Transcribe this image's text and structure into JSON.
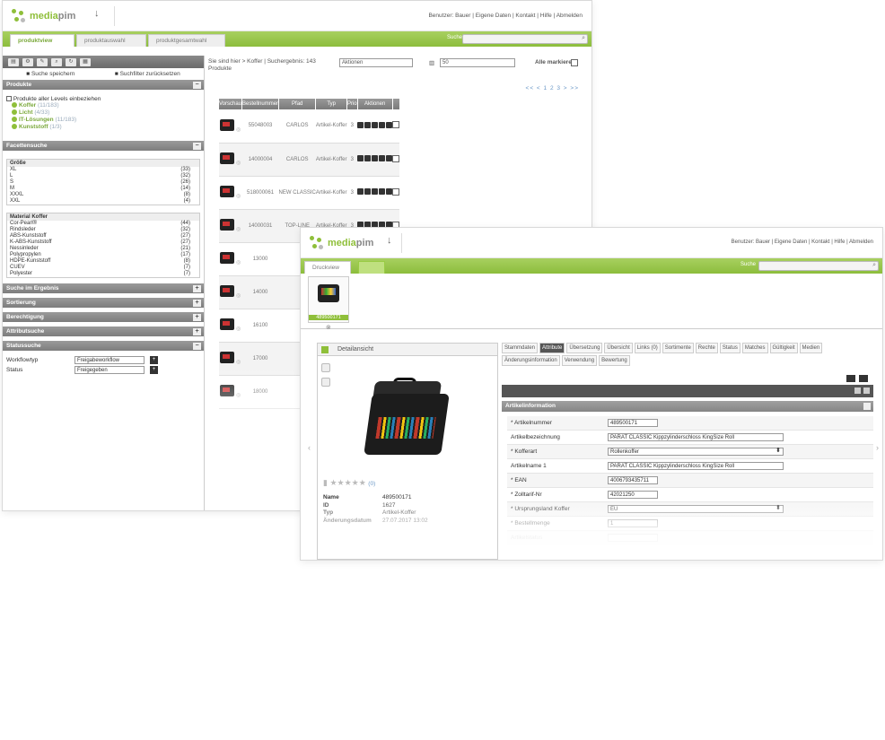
{
  "window1": {
    "user_links": "Benutzer: Bauer  |  Eigene Daten  |  Kontakt  |  Hilfe  |  Abmelden",
    "tabs": [
      "produktview",
      "produktauswahl",
      "produktgesamtwahl"
    ],
    "search_label": "Suche",
    "sidebar": {
      "save_search": "Suche speichern",
      "reset_filter": "Suchfilter zurücksetzen",
      "produkte_header": "Produkte",
      "include_all_levels": "Produkte aller Levels einbeziehen",
      "tree": [
        {
          "name": "Koffer",
          "count": "(11/183)"
        },
        {
          "name": "Licht",
          "count": "(4/33)"
        },
        {
          "name": "IT-Lösungen",
          "count": "(11/183)"
        },
        {
          "name": "Kunststoff",
          "count": "(1/3)"
        }
      ],
      "facet_header": "Facettensuche",
      "groesse_title": "Größe",
      "groesse": [
        {
          "k": "XL",
          "v": "(33)"
        },
        {
          "k": "L",
          "v": "(32)"
        },
        {
          "k": "S",
          "v": "(26)"
        },
        {
          "k": "M",
          "v": "(14)"
        },
        {
          "k": "XXXL",
          "v": "(8)"
        },
        {
          "k": "XXL",
          "v": "(4)"
        }
      ],
      "material_title": "Material Koffer",
      "material": [
        {
          "k": "Cor-Pearl®",
          "v": "(44)"
        },
        {
          "k": "Rindsleder",
          "v": "(32)"
        },
        {
          "k": "ABS-Kunststoff",
          "v": "(27)"
        },
        {
          "k": "K-ABS-Kunststoff",
          "v": "(27)"
        },
        {
          "k": "Nessinleder",
          "v": "(21)"
        },
        {
          "k": "Polypropylen",
          "v": "(17)"
        },
        {
          "k": "HDPE-Kunststoff",
          "v": "(8)"
        },
        {
          "k": "CUEV",
          "v": "(7)"
        },
        {
          "k": "Polyester",
          "v": "(7)"
        }
      ],
      "sections": [
        "Suche im Ergebnis",
        "Sortierung",
        "Berechtigung",
        "Attributsuche",
        "Statussuche"
      ],
      "workflow_label": "Workflowtyp",
      "workflow_value": "Freigabeworkflow",
      "status_label": "Status",
      "status_value": "Freigegeben"
    },
    "main": {
      "breadcrumb": "Sie sind hier > Koffer | Suchergebnis: 143 Produkte",
      "aktionen": "Aktionen",
      "per_page": "50",
      "mark_all": "Alle markieren",
      "pager": "<< <   1 2 3   > >>",
      "columns": [
        "Vorschau",
        "Bestellnummer",
        "Pfad",
        "Typ",
        "Prio",
        "Aktionen",
        ""
      ],
      "rows": [
        {
          "nr": "55048003",
          "pfad": "CARLOS",
          "typ": "Artikel-Koffer",
          "prio": "3"
        },
        {
          "nr": "14000004",
          "pfad": "CARLOS",
          "typ": "Artikel-Koffer",
          "prio": "3"
        },
        {
          "nr": "518000061",
          "pfad": "NEW CLASSIC",
          "typ": "Artikel-Koffer",
          "prio": "3"
        },
        {
          "nr": "14000031",
          "pfad": "TOP-LINE",
          "typ": "Artikel-Koffer",
          "prio": "3"
        },
        {
          "nr": "13000",
          "pfad": "",
          "typ": "",
          "prio": ""
        },
        {
          "nr": "14000",
          "pfad": "",
          "typ": "",
          "prio": ""
        },
        {
          "nr": "16100",
          "pfad": "",
          "typ": "",
          "prio": ""
        },
        {
          "nr": "17000",
          "pfad": "",
          "typ": "",
          "prio": ""
        },
        {
          "nr": "18000",
          "pfad": "",
          "typ": "",
          "prio": ""
        }
      ]
    }
  },
  "window2": {
    "user_links": "Benutzer: Bauer  |  Eigene Daten  |  Kontakt  |  Hilfe  |  Abmelden",
    "tab": "Druckview",
    "search_label": "Suche",
    "thumb_caption": "489500171",
    "detail_title": "Detailansicht",
    "rating_count": "(0)",
    "props": [
      {
        "k": "Name",
        "v": "489500171"
      },
      {
        "k": "ID",
        "v": "1627"
      },
      {
        "k": "Typ",
        "v": "Artikel-Koffer"
      },
      {
        "k": "Änderungsdatum",
        "v": "27.07.2017 13:02"
      }
    ],
    "editor_tabs": [
      "Stammdaten",
      "Attribute",
      "Übersetzung",
      "Übersicht",
      "Links (0)",
      "Sortimente",
      "Rechte",
      "Status",
      "Matches",
      "Gültigkeit",
      "Medien",
      "Änderungsinformation",
      "Verwendung",
      "Bewertung"
    ],
    "active_tab": "Attribute",
    "section_title": "Artikelinformation",
    "fields": [
      {
        "label": "* Artikelnummer",
        "value": "489500171",
        "type": "text",
        "w": 56
      },
      {
        "label": "Artikelbezeichnung",
        "value": "PARAT CLASSIC Kippzylinderschloss KingSize Roll",
        "type": "text",
        "w": 196
      },
      {
        "label": "* Kofferart",
        "value": "Rollenkoffer",
        "type": "select",
        "w": 196
      },
      {
        "label": "Artikelname 1",
        "value": "PARAT CLASSIC Kippzylinderschloss KingSize Roll",
        "type": "text",
        "w": 196
      },
      {
        "label": "* EAN",
        "value": "4006793435711",
        "type": "text",
        "w": 56
      },
      {
        "label": "* Zolltarif-Nr",
        "value": "42021250",
        "type": "text",
        "w": 56
      },
      {
        "label": "* Ursprungsland Koffer",
        "value": "EU",
        "type": "select",
        "w": 196
      },
      {
        "label": "* Bestellmenge",
        "value": "1",
        "type": "text",
        "w": 56
      },
      {
        "label": "Artikelstatus",
        "value": "",
        "type": "text",
        "w": 56
      }
    ]
  }
}
